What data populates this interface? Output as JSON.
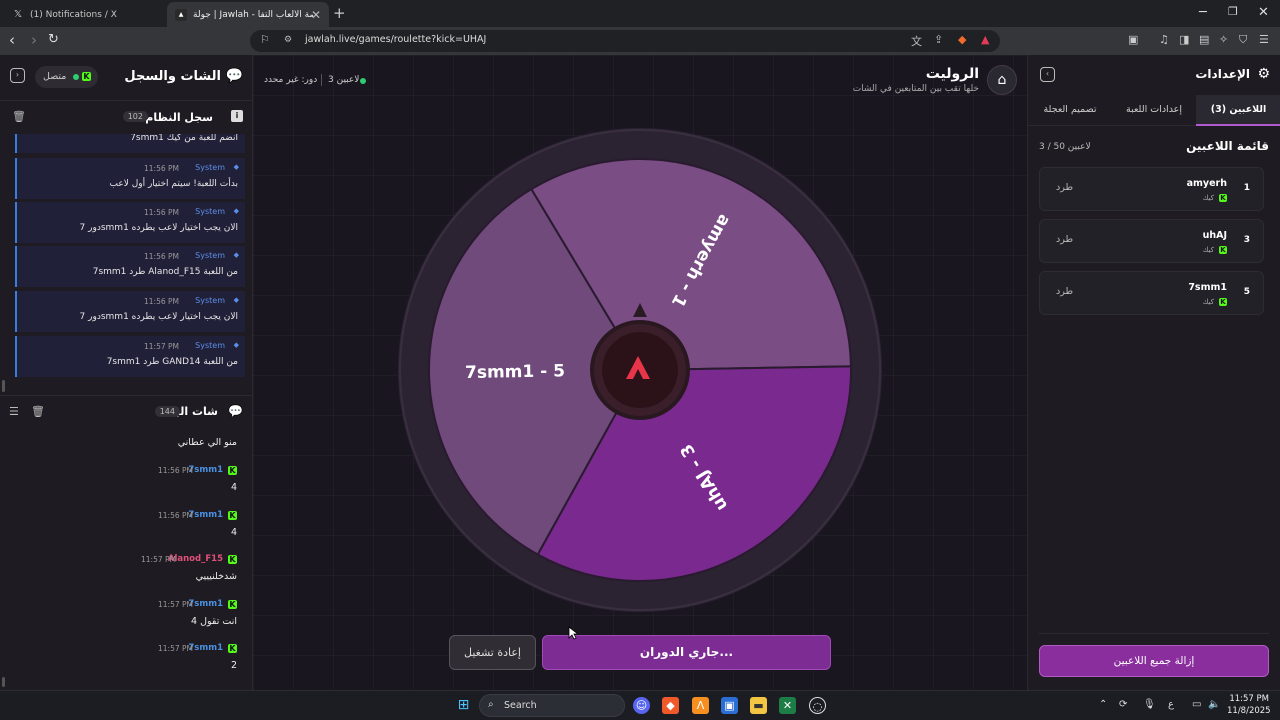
{
  "browser": {
    "tabs": [
      {
        "title": "(1) Notifications / X",
        "favicon": "x-logo-icon"
      },
      {
        "title": "جولة | Jawlah - منصة الألعاب التفا",
        "favicon": "jawlah-logo-icon"
      }
    ],
    "new_tab": "+",
    "url": "jawlah.live/games/roulette?kick=UHAJ"
  },
  "left_panel": {
    "title": "الشات والسجل",
    "connection": "متصل",
    "system_log": {
      "title": "سجل النظام",
      "count": "102",
      "partial_first": "7smm1 انضم للعبة من كيك",
      "items": [
        {
          "sender": "System",
          "time": "11:56 PM",
          "text": "بدأت اللعبة! سيتم اختيار أول لاعب"
        },
        {
          "sender": "System",
          "time": "11:56 PM",
          "text": "دور 7smm1 الان يجب اختيار لاعب يطرده"
        },
        {
          "sender": "System",
          "time": "11:56 PM",
          "text": "7smm1 طرد Alanod_F15 من اللعبة"
        },
        {
          "sender": "System",
          "time": "11:56 PM",
          "text": "دور 7smm1 الان يجب اختيار لاعب يطرده"
        },
        {
          "sender": "System",
          "time": "11:57 PM",
          "text": "7smm1 طرد GAND14 من اللعبة"
        }
      ]
    },
    "chat": {
      "title": "شات البث",
      "count": "144",
      "partial_first": "منو الي عطاني",
      "messages": [
        {
          "user": "7smm1",
          "time": "11:56 PM",
          "text": "4",
          "color": "#4a90e2"
        },
        {
          "user": "7smm1",
          "time": "11:56 PM",
          "text": "4",
          "color": "#4a90e2"
        },
        {
          "user": "Alanod_F15",
          "time": "11:57 PM",
          "text": "شدخلنيييي",
          "color": "#e0507a"
        },
        {
          "user": "7smm1",
          "time": "11:57 PM",
          "text": "انت تقول 4",
          "color": "#4a90e2"
        },
        {
          "user": "7smm1",
          "time": "11:57 PM",
          "text": "2",
          "color": "#4a90e2"
        }
      ]
    }
  },
  "center": {
    "title": "الروليت",
    "subtitle": "خلها تقب بين المتابعين في الشات",
    "player_count": "3 لاعبين",
    "turn": "دور: غير محدد",
    "wheel": {
      "segments": [
        {
          "label": "amyerh - 1",
          "color": "#7a4d85"
        },
        {
          "label": "uhAJ - 3",
          "color": "#7a2a8e"
        },
        {
          "label": "7smm1 - 5",
          "color": "#6f4a7a"
        }
      ]
    },
    "spin_button": "جاري الدوران...",
    "replay_button": "إعادة تشغيل"
  },
  "right_panel": {
    "title": "الإعدادات",
    "tabs": [
      "اللاعبين (3)",
      "إعدادات اللعبة",
      "تصميم العجلة"
    ],
    "players_title": "قائمة اللاعبين",
    "players_count": "3 / 50 لاعبين",
    "players": [
      {
        "num": "1",
        "name": "amyerh",
        "platform": "كيك",
        "kick_label": "طرد"
      },
      {
        "num": "3",
        "name": "uhAJ",
        "platform": "كيك",
        "kick_label": "طرد"
      },
      {
        "num": "5",
        "name": "7smm1",
        "platform": "كيك",
        "kick_label": "طرد"
      }
    ],
    "remove_all": "إزالة جميع اللاعبين"
  },
  "taskbar": {
    "search": "Search",
    "time": "11:57 PM",
    "date": "11/8/2025",
    "lang": "ع"
  },
  "colors": {
    "accent": "#8a2d9d",
    "kick_green": "#53fc18",
    "system_blue": "#5b8fe8"
  }
}
